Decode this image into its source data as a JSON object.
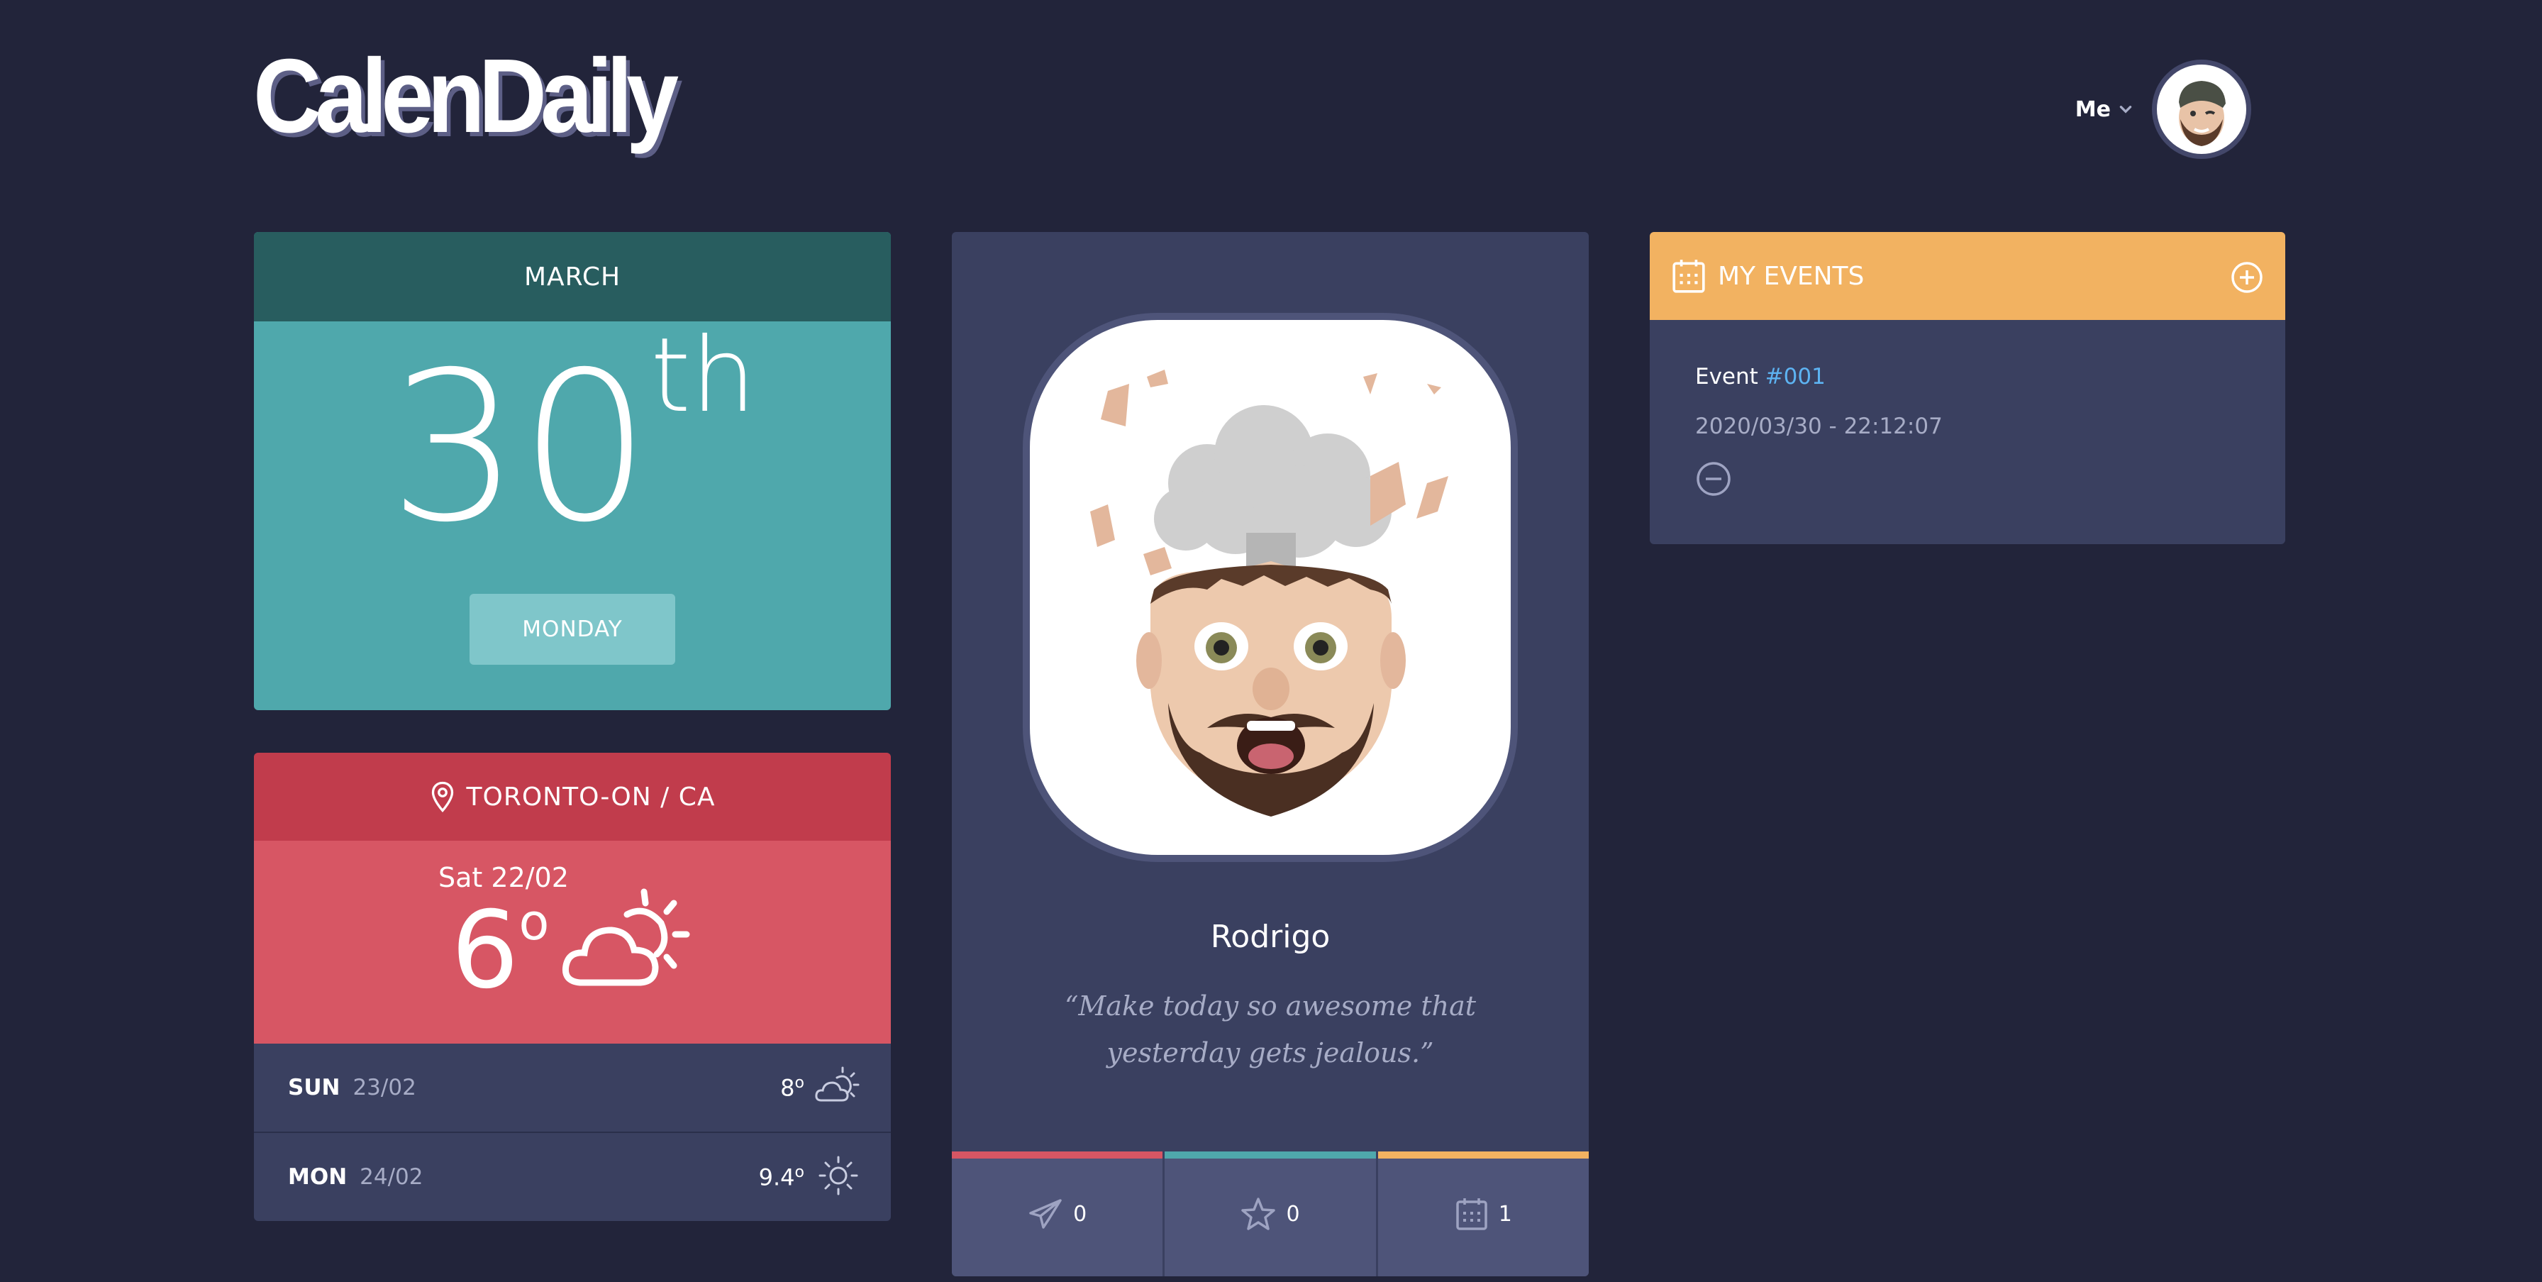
{
  "header": {
    "logo": "CalenDaily",
    "user_label": "Me"
  },
  "date_card": {
    "month": "MARCH",
    "day_number": "30",
    "suffix": "th",
    "weekday": "MONDAY"
  },
  "weather": {
    "location": "TORONTO-ON / CA",
    "today": {
      "date": "Sat 22/02",
      "temp": "6",
      "unit": "o",
      "icon": "partly-cloudy-icon"
    },
    "forecast": [
      {
        "day": "SUN",
        "date": "23/02",
        "temp": "8",
        "unit": "o",
        "icon": "partly-cloudy-icon"
      },
      {
        "day": "MON",
        "date": "24/02",
        "temp": "9.4",
        "unit": "o",
        "icon": "sun-icon"
      }
    ]
  },
  "profile": {
    "name": "Rodrigo",
    "quote": "“Make today so awesome that yesterday gets jealous.”",
    "stats": [
      {
        "icon": "send-icon",
        "value": "0",
        "color": "#d75664"
      },
      {
        "icon": "star-icon",
        "value": "0",
        "color": "#4fa8ac"
      },
      {
        "icon": "calendar-icon",
        "value": "1",
        "color": "#f2b261"
      }
    ]
  },
  "events": {
    "title": "MY EVENTS",
    "items": [
      {
        "label": "Event",
        "id": "#001",
        "datetime": "2020/03/30 - 22:12:07"
      }
    ]
  }
}
